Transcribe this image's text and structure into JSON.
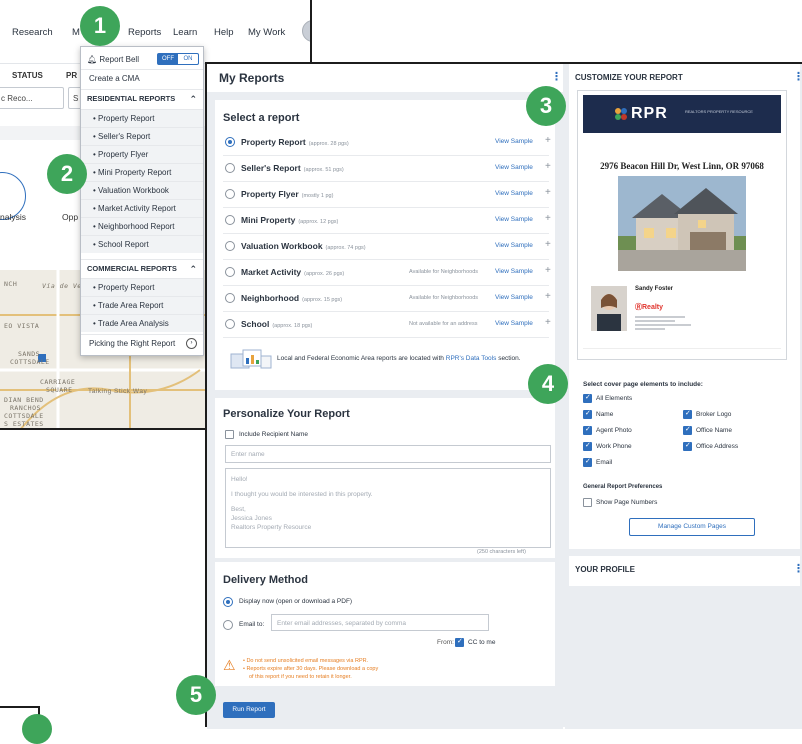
{
  "nav": {
    "items": [
      "Research",
      "M",
      "Reports",
      "Learn",
      "Help",
      "My Work"
    ]
  },
  "filters": {
    "status_label": "STATUS",
    "pr_label": "PR",
    "status_value": "c Reco...",
    "second_value": "S"
  },
  "cards": {
    "analysis": "nalysis",
    "opp": "Opp"
  },
  "map_labels": [
    "NCH",
    "Vía de Ventura",
    "EO VISTA",
    "SANDS",
    "COTTSDALE",
    "CARRIAGE",
    "SQUARE",
    "DIAN BEND",
    "RANCHOS",
    "COTTSDALE",
    "S ESTATES",
    "Talking Stick Way"
  ],
  "dropdown": {
    "bell_label": "Report Bell",
    "toggle_off": "OFF",
    "toggle_on": "ON",
    "create_cma": "Create a CMA",
    "residential_head": "RESIDENTIAL REPORTS",
    "residential_items": [
      "Property Report",
      "Seller's Report",
      "Property Flyer",
      "Mini Property Report",
      "Valuation Workbook",
      "Market Activity Report",
      "Neighborhood Report",
      "School Report"
    ],
    "commercial_head": "COMMERCIAL REPORTS",
    "commercial_items": [
      "Property Report",
      "Trade Area Report",
      "Trade Area Analysis"
    ],
    "footer": "Picking the Right Report"
  },
  "my_reports": {
    "title": "My Reports",
    "select_title": "Select a report",
    "reports": [
      {
        "name": "Property Report",
        "pages": "(approx. 28 pgs)",
        "avail": "",
        "selected": true
      },
      {
        "name": "Seller's Report",
        "pages": "(approx. 51 pgs)",
        "avail": "",
        "selected": false
      },
      {
        "name": "Property Flyer",
        "pages": "(mostly 1 pg)",
        "avail": "",
        "selected": false
      },
      {
        "name": "Mini Property",
        "pages": "(approx. 12 pgs)",
        "avail": "",
        "selected": false
      },
      {
        "name": "Valuation Workbook",
        "pages": "(approx. 74 pgs)",
        "avail": "",
        "selected": false
      },
      {
        "name": "Market Activity",
        "pages": "(approx. 26 pgs)",
        "avail": "Available for Neighborhoods",
        "selected": false
      },
      {
        "name": "Neighborhood",
        "pages": "(approx. 15 pgs)",
        "avail": "Available for Neighborhoods",
        "selected": false
      },
      {
        "name": "School",
        "pages": "(approx. 18 pgs)",
        "avail": "Not available for an address",
        "selected": false
      }
    ],
    "view_sample": "View Sample",
    "econ_text": "Local and Federal Economic Area reports are located with",
    "econ_link": "RPR's Data Tools",
    "econ_suffix": "section."
  },
  "personalize": {
    "title": "Personalize Your Report",
    "include_label": "Include Recipient Name",
    "name_placeholder": "Enter name",
    "message_lines": [
      "Hello!",
      "",
      "I thought you would be interested in this property.",
      "",
      "Best,",
      "Jessica Jones",
      "Realtors Property Resource"
    ],
    "char_count": "(250 characters left)"
  },
  "delivery": {
    "title": "Delivery Method",
    "option_display": "Display now (open or download a PDF)",
    "option_email": "Email to:",
    "email_placeholder": "Enter email addresses, separated by comma",
    "from_label": "From:",
    "cc_label": "CC to me",
    "warn_1": "• Do not send unsolicited email messages via RPR.",
    "warn_2": "• Reports expire after 30 days. Please download a copy",
    "warn_3": "of this report if you need to retain it longer.",
    "run_button": "Run Report"
  },
  "customize": {
    "title": "CUSTOMIZE YOUR REPORT",
    "rpr_logo": "RPR",
    "rpr_sub": "REALTORS PROPERTY RESOURCE",
    "address": "2976 Beacon Hill Dr, West Linn, OR 97068",
    "agent_name": "Sandy Foster",
    "office_logo": "Realty",
    "cover_head": "Select cover page elements to include:",
    "elements_all": "All Elements",
    "elements_left": [
      "Name",
      "Agent Photo",
      "Work Phone",
      "Email"
    ],
    "elements_right": [
      "Broker Logo",
      "Office Name",
      "Office Address"
    ],
    "prefs_head": "General Report Preferences",
    "show_page_numbers": "Show Page Numbers",
    "manage_button": "Manage Custom Pages"
  },
  "profile": {
    "title": "YOUR PROFILE"
  },
  "steps": [
    "1",
    "2",
    "3",
    "4",
    "5"
  ],
  "colors": {
    "accent": "#2f6fbd",
    "badge": "#3ea55a",
    "warning": "#e67e22"
  }
}
